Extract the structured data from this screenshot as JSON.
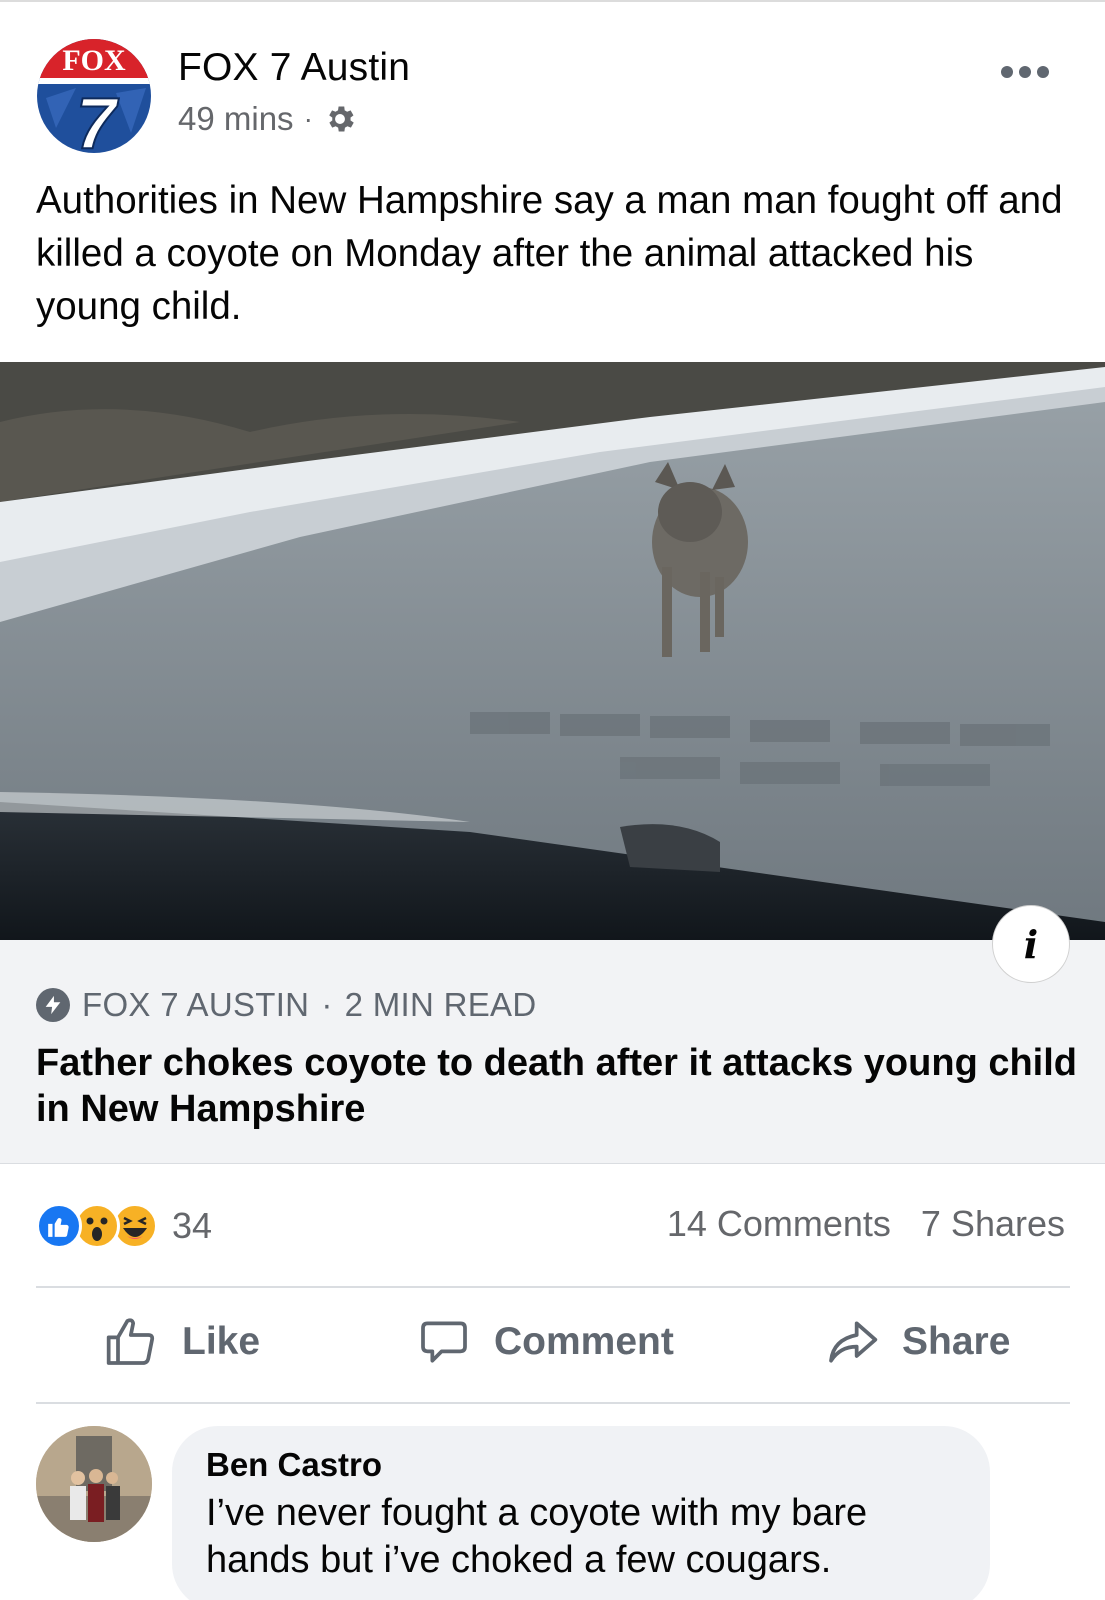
{
  "post": {
    "page_name": "FOX 7 Austin",
    "time": "49 mins",
    "meta_separator": "·",
    "privacy_icon": "gear-icon",
    "text": "Authorities in New Hampshire say a man man fought off and killed a coyote on Monday after the animal attacked his young child.",
    "logo": {
      "top_text": "FOX",
      "number": "7"
    }
  },
  "link_card": {
    "source": "FOX 7 AUSTIN",
    "separator": "·",
    "read_time": "2 MIN READ",
    "headline": "Father chokes coyote to death after it attacks young child in New Hampshire",
    "info_label": "i"
  },
  "engagement": {
    "reaction_count": "34",
    "reactions": [
      "like-icon",
      "wow-icon",
      "haha-icon"
    ],
    "comments": "14 Comments",
    "shares": "7 Shares"
  },
  "actions": {
    "like": "Like",
    "comment": "Comment",
    "share": "Share"
  },
  "comment": {
    "author": "Ben Castro",
    "text": "I’ve never fought a coyote with my bare hands but i’ve choked a few cougars."
  },
  "colors": {
    "fox_blue": "#1f4f9c",
    "fox_red": "#d8232a",
    "like_blue": "#1877f2",
    "reaction_yellow": "#f7b125",
    "secondary_text": "#65676b"
  }
}
